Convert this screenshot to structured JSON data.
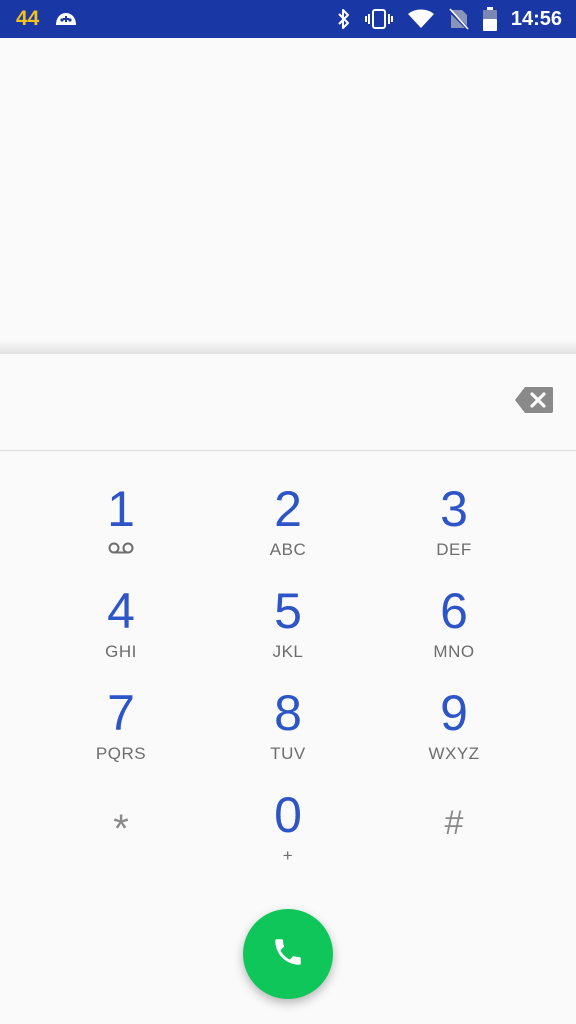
{
  "status_bar": {
    "notification_count": "44",
    "time": "14:56",
    "icons": [
      "game-controller-icon",
      "bluetooth-icon",
      "vibrate-icon",
      "wifi-icon",
      "no-sim-icon",
      "battery-icon"
    ],
    "background_color": "#1a37a6",
    "count_color": "#f2c21b"
  },
  "dialer": {
    "digits_value": "",
    "backspace_icon": "backspace-icon",
    "keys": [
      {
        "digit": "1",
        "letters": "",
        "sub_icon": "voicemail-icon"
      },
      {
        "digit": "2",
        "letters": "ABC"
      },
      {
        "digit": "3",
        "letters": "DEF"
      },
      {
        "digit": "4",
        "letters": "GHI"
      },
      {
        "digit": "5",
        "letters": "JKL"
      },
      {
        "digit": "6",
        "letters": "MNO"
      },
      {
        "digit": "7",
        "letters": "PQRS"
      },
      {
        "digit": "8",
        "letters": "TUV"
      },
      {
        "digit": "9",
        "letters": "WXYZ"
      },
      {
        "digit": "*",
        "letters": ""
      },
      {
        "digit": "0",
        "letters": "+"
      },
      {
        "digit": "#",
        "letters": ""
      }
    ],
    "call_icon": "phone-icon",
    "digit_color": "#2d55c8",
    "call_color": "#0fc65b"
  }
}
